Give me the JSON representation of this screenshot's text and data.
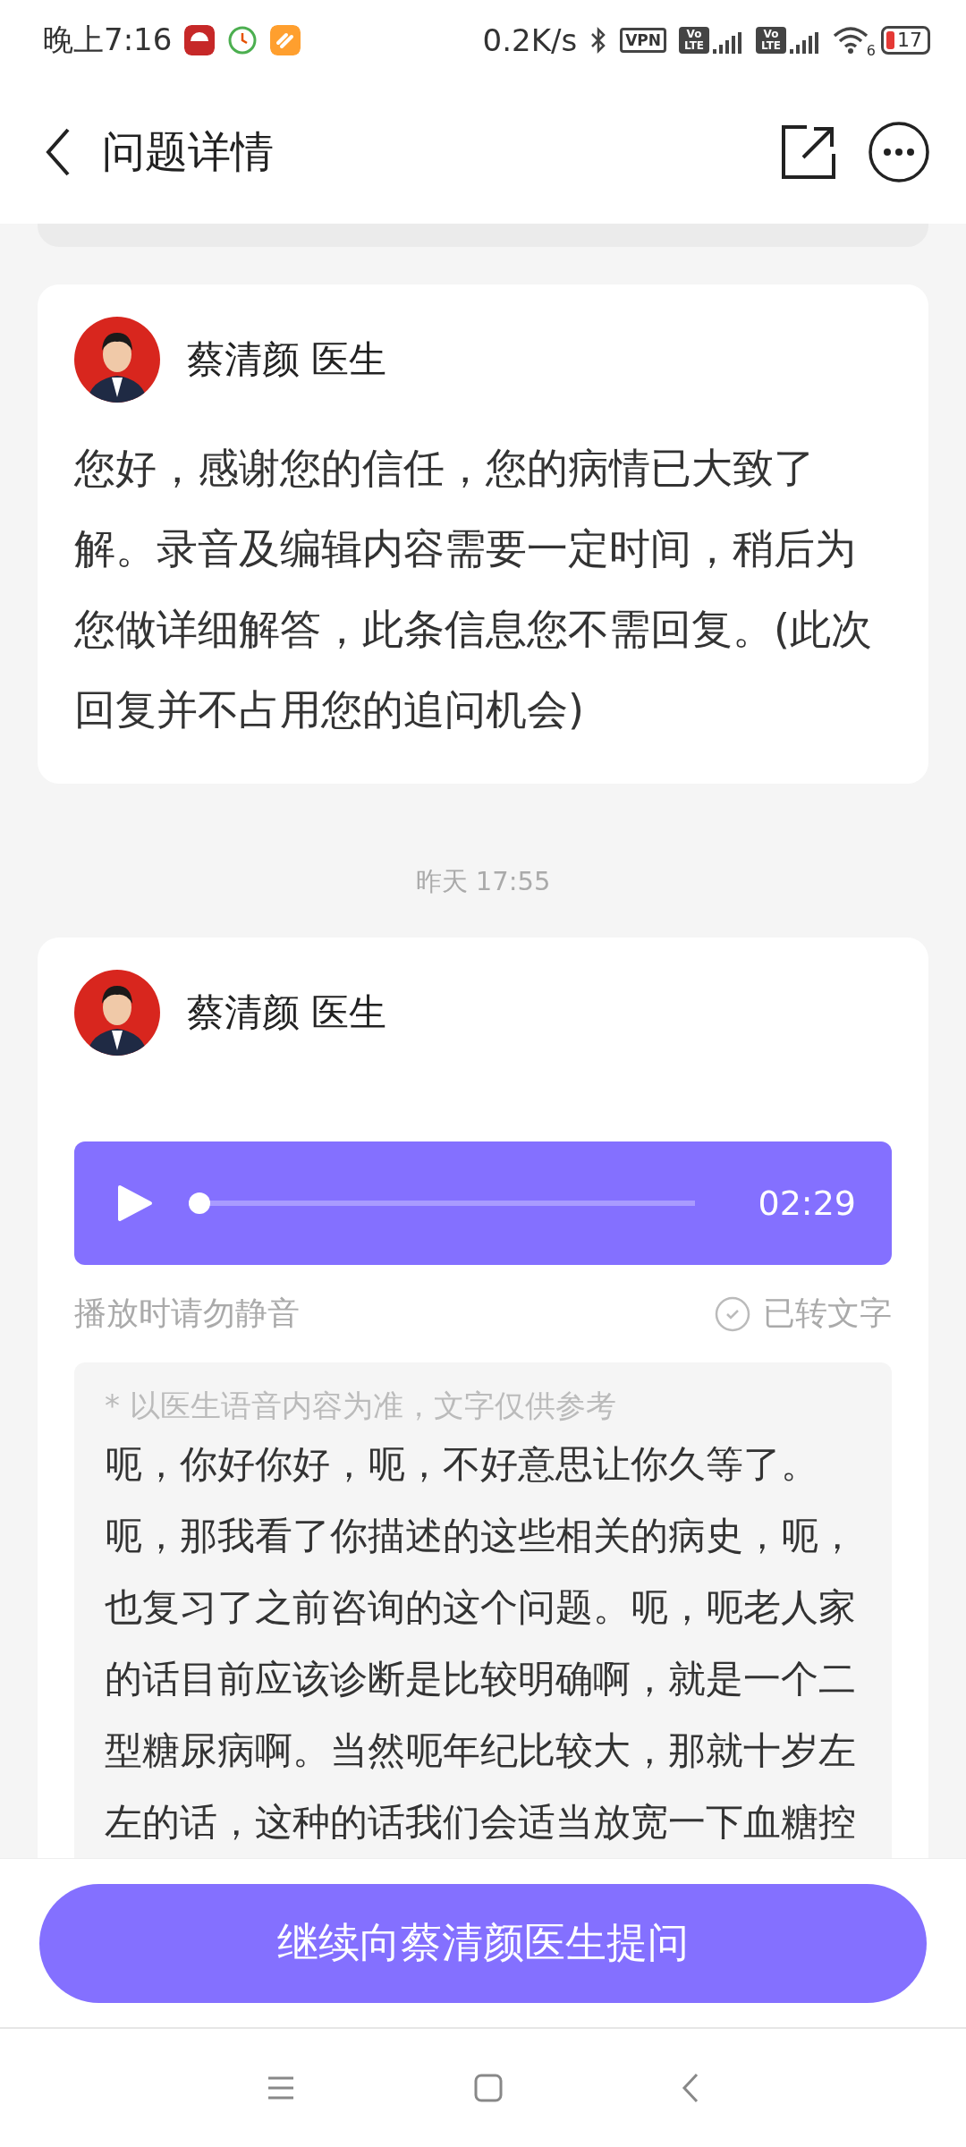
{
  "status_bar": {
    "time": "晚上7:16",
    "net_speed": "0.2K/s",
    "vpn": "VPN",
    "sims": [
      {
        "top": "Vo",
        "bottom": "LTE"
      },
      {
        "top": "Vo",
        "bottom": "LTE"
      }
    ],
    "wifi_badge": "6",
    "battery": "17"
  },
  "header": {
    "title": "问题详情"
  },
  "messages": [
    {
      "kind": "text",
      "sender": "蔡清颜 医生",
      "text": "您好，感谢您的信任，您的病情已大致了解。录音及编辑内容需要一定时间，稍后为您做详细解答，此条信息您不需回复。(此次回复并不占用您的追问机会)"
    },
    {
      "kind": "voice",
      "timestamp": "昨天 17:55",
      "sender": "蔡清颜 医生",
      "duration": "02:29",
      "level": 0,
      "hint": "播放时请勿静音",
      "transcribed": "已转文字",
      "note": "* 以医生语音内容为准，文字仅供参考",
      "paragraphs": [
        "呃，你好你好，呃，不好意思让你久等了。",
        "呃，那我看了你描述的这些相关的病史，呃，也复习了之前咨询的这个问题。呃，呃老人家的话目前应该诊断是比较明确啊，就是一个二型糖尿病啊。当然呃年纪比较大，那就十岁左左的话，这种的话我们会适当放宽一下血糖控"
      ]
    }
  ],
  "action_button": "继续向蔡清颜医生提问"
}
